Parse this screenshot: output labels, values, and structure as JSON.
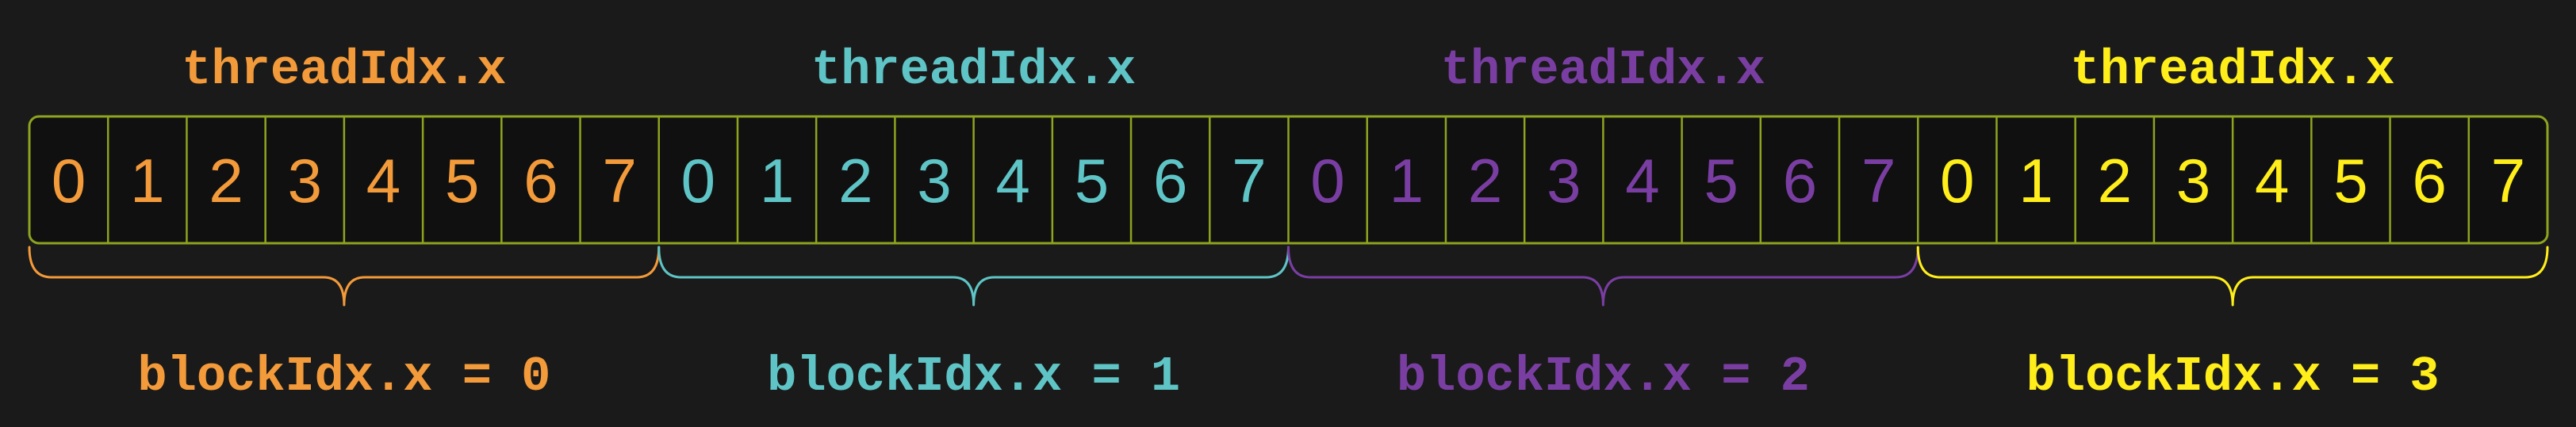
{
  "diagram": {
    "background": "#1a1a1a",
    "grid_border_color": "#8ea31f",
    "cell_fill": "#101010",
    "thread_label": "threadIdx.x",
    "blocks": [
      {
        "thread_label": "threadIdx.x",
        "block_label": "blockIdx.x = 0",
        "color": "#f39a3a",
        "threads": [
          "0",
          "1",
          "2",
          "3",
          "4",
          "5",
          "6",
          "7"
        ]
      },
      {
        "thread_label": "threadIdx.x",
        "block_label": "blockIdx.x = 1",
        "color": "#5fc4c6",
        "threads": [
          "0",
          "1",
          "2",
          "3",
          "4",
          "5",
          "6",
          "7"
        ]
      },
      {
        "thread_label": "threadIdx.x",
        "block_label": "blockIdx.x = 2",
        "color": "#7a3ea3",
        "threads": [
          "0",
          "1",
          "2",
          "3",
          "4",
          "5",
          "6",
          "7"
        ]
      },
      {
        "thread_label": "threadIdx.x",
        "block_label": "blockIdx.x = 3",
        "color": "#ffee1a",
        "threads": [
          "0",
          "1",
          "2",
          "3",
          "4",
          "5",
          "6",
          "7"
        ]
      }
    ]
  }
}
